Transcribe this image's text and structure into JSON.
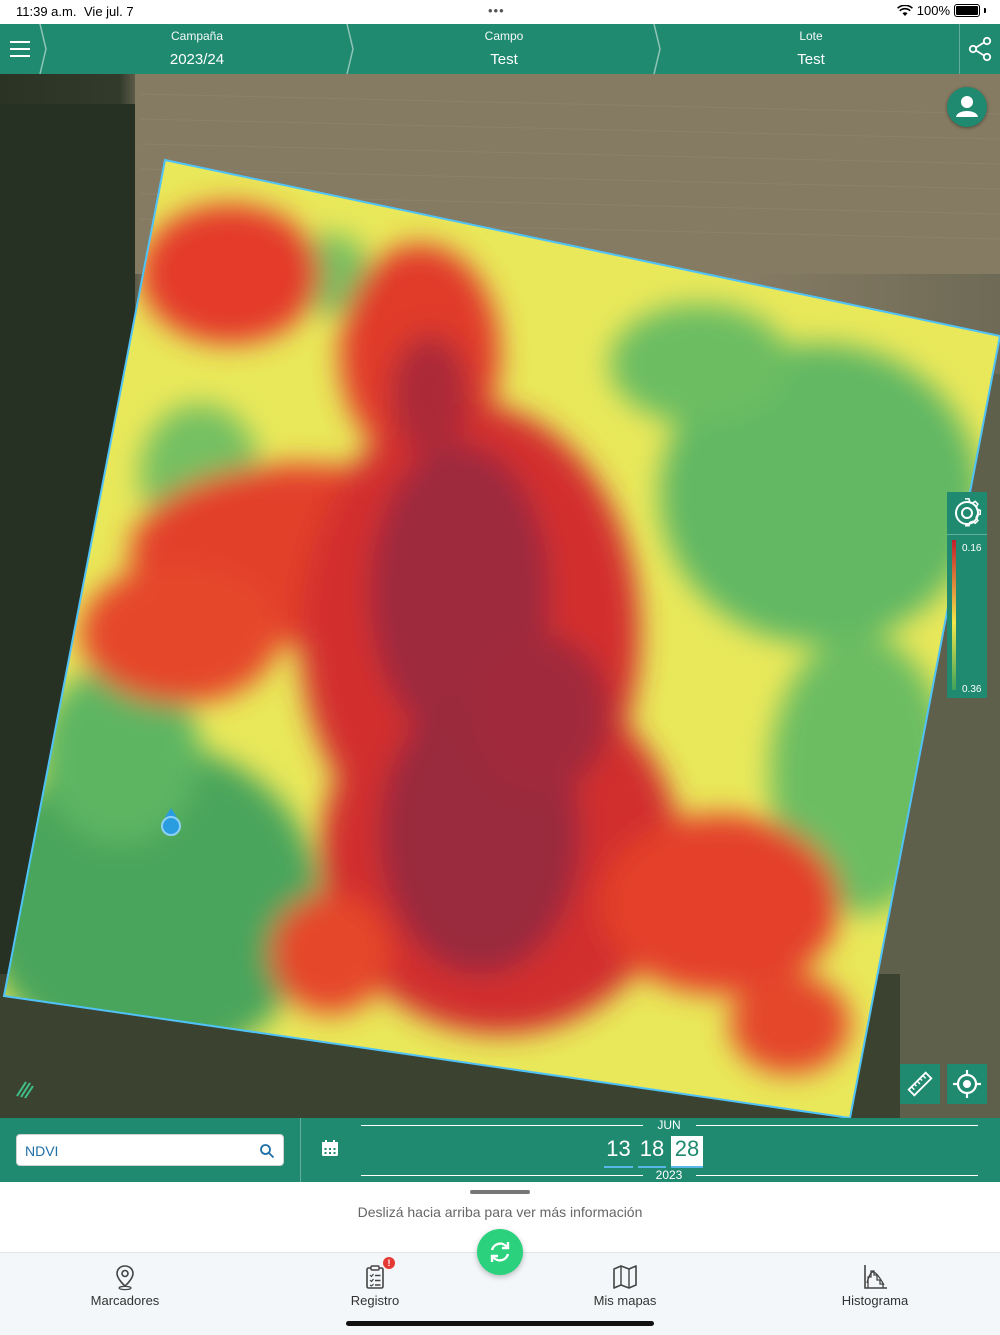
{
  "status_bar": {
    "time": "11:39 a.m.",
    "date": "Vie jul. 7",
    "battery": "100%"
  },
  "header": {
    "crumbs": [
      {
        "label": "Campaña",
        "value": "2023/24"
      },
      {
        "label": "Campo",
        "value": "Test"
      },
      {
        "label": "Lote",
        "value": "Test"
      }
    ]
  },
  "map": {
    "legend": {
      "top_value": "0.16",
      "bottom_value": "0.36"
    },
    "colors": {
      "low": "#c21f2b",
      "mid": "#f3e64a",
      "high": "#3ea35b",
      "boundary": "#4fc3f7"
    }
  },
  "layer_selector": {
    "value": "NDVI",
    "placeholder": ""
  },
  "date_picker": {
    "month": "JUN",
    "days": [
      "13",
      "18",
      "28"
    ],
    "selected_day": "28",
    "year": "2023"
  },
  "sheet": {
    "hint": "Deslizá hacia arriba para ver más información"
  },
  "tabs": [
    {
      "label": "Marcadores",
      "icon": "map-pin-icon"
    },
    {
      "label": "Registro",
      "icon": "clipboard-list-icon",
      "badge": "!"
    },
    {
      "label": "Mis mapas",
      "icon": "folded-map-icon"
    },
    {
      "label": "Histograma",
      "icon": "histogram-icon"
    }
  ],
  "theme": {
    "primary": "#1f8a70",
    "accent": "#2bd17c"
  }
}
